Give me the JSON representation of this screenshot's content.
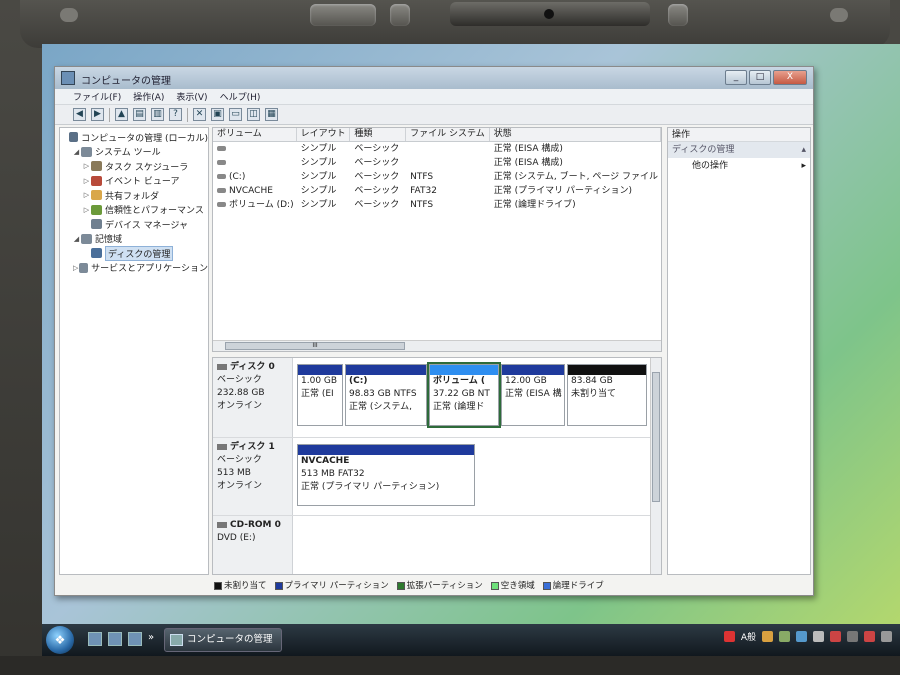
{
  "window": {
    "title": "コンピュータの管理",
    "buttons": {
      "minimize": "_",
      "maximize": "□",
      "close": "X"
    }
  },
  "menu": [
    "ファイル(F)",
    "操作(A)",
    "表示(V)",
    "ヘルプ(H)"
  ],
  "toolbar_icons": [
    "back-arrow-icon",
    "forward-arrow-icon",
    "up-folder-icon",
    "show-hide-tree-icon",
    "properties-icon",
    "help-icon",
    "delete-icon",
    "open-icon",
    "folder-icon",
    "refresh-icon",
    "export-icon"
  ],
  "tree": [
    {
      "label": "コンピュータの管理 (ローカル)",
      "level": 0,
      "expander": "",
      "icon": "computer-icon",
      "color": "#5a6f86"
    },
    {
      "label": "システム ツール",
      "level": 1,
      "expander": "◢",
      "icon": "tools-icon",
      "color": "#7c8a98"
    },
    {
      "label": "タスク スケジューラ",
      "level": 2,
      "expander": "▷",
      "icon": "clock-icon",
      "color": "#8a7a5a"
    },
    {
      "label": "イベント ビューア",
      "level": 2,
      "expander": "▷",
      "icon": "event-icon",
      "color": "#b84a3a"
    },
    {
      "label": "共有フォルダ",
      "level": 2,
      "expander": "▷",
      "icon": "shared-folder-icon",
      "color": "#d9a74a"
    },
    {
      "label": "信頼性とパフォーマンス",
      "level": 2,
      "expander": "▷",
      "icon": "performance-icon",
      "color": "#6b9a3a"
    },
    {
      "label": "デバイス マネージャ",
      "level": 2,
      "expander": "",
      "icon": "device-icon",
      "color": "#6f7f8f"
    },
    {
      "label": "記憶域",
      "level": 1,
      "expander": "◢",
      "icon": "storage-icon",
      "color": "#7c8a98"
    },
    {
      "label": "ディスクの管理",
      "level": 2,
      "expander": "",
      "icon": "disk-icon",
      "color": "#4a6f9a"
    },
    {
      "label": "サービスとアプリケーション",
      "level": 1,
      "expander": "▷",
      "icon": "services-icon",
      "color": "#7c8a98"
    }
  ],
  "list": {
    "columns": [
      "ボリューム",
      "レイアウト",
      "種類",
      "ファイル システム",
      "状態"
    ],
    "rows": [
      [
        "",
        "シンプル",
        "ベーシック",
        "",
        "正常 (EISA 構成)"
      ],
      [
        "",
        "シンプル",
        "ベーシック",
        "",
        "正常 (EISA 構成)"
      ],
      [
        "(C:)",
        "シンプル",
        "ベーシック",
        "NTFS",
        "正常 (システム, ブート, ページ ファイル"
      ],
      [
        "NVCACHE",
        "シンプル",
        "ベーシック",
        "FAT32",
        "正常 (プライマリ パーティション)"
      ],
      [
        "ボリューム (D:)",
        "シンプル",
        "ベーシック",
        "NTFS",
        "正常 (論理ドライブ)"
      ]
    ],
    "scroll_thumb": "III"
  },
  "disks": [
    {
      "name": "ディスク 0",
      "type": "ベーシック",
      "size": "232.88 GB",
      "status": "オンライン",
      "partitions": [
        {
          "title": "",
          "line1": "1.00 GB",
          "line2": "正常 (EI",
          "bar": "#1f3a9c"
        },
        {
          "title": "(C:)",
          "line1": "98.83 GB NTFS",
          "line2": "正常 (システム,",
          "bar": "#1f3a9c"
        },
        {
          "title": "ボリューム (",
          "line1": "37.22 GB NT",
          "line2": "正常 (論理ド",
          "bar": "#2e8ef0",
          "selected": true
        },
        {
          "title": "",
          "line1": "12.00 GB",
          "line2": "正常 (EISA 構",
          "bar": "#1f3a9c"
        },
        {
          "title": "",
          "line1": "83.84 GB",
          "line2": "未割り当て",
          "bar": "#111111"
        }
      ]
    },
    {
      "name": "ディスク 1",
      "type": "ベーシック",
      "size": "513 MB",
      "status": "オンライン",
      "partitions": [
        {
          "title": "NVCACHE",
          "line1": "513 MB FAT32",
          "line2": "正常 (プライマリ パーティション)",
          "bar": "#1f3a9c"
        }
      ]
    },
    {
      "name": "CD-ROM 0",
      "type": "DVD (E:)",
      "size": "",
      "status": "",
      "partitions": []
    }
  ],
  "legend": [
    {
      "label": "未割り当て",
      "color": "#111111"
    },
    {
      "label": "プライマリ パーティション",
      "color": "#1f3a9c"
    },
    {
      "label": "拡張パーティション",
      "color": "#2f7a2f"
    },
    {
      "label": "空き領域",
      "color": "#6ee07a"
    },
    {
      "label": "論理ドライブ",
      "color": "#3a6fd8"
    }
  ],
  "actions": {
    "header": "操作",
    "section": "ディスクの管理",
    "item": "他の操作",
    "arrow_up": "▴",
    "arrow_right": "▸"
  },
  "taskbar": {
    "start_glyph": "❖",
    "task_label": "コンピュータの管理",
    "tray_text": "A般",
    "quick_launch": "»"
  }
}
